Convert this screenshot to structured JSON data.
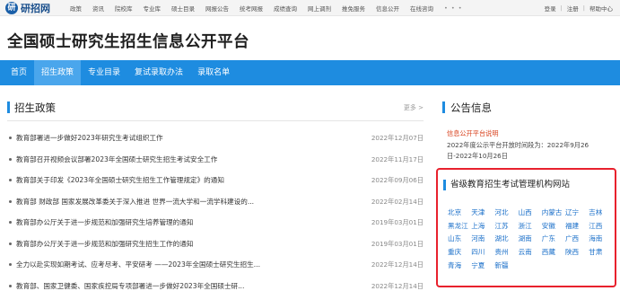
{
  "topbar": {
    "logo_mark": "研",
    "logo_text": "研招网",
    "nav": [
      "政策",
      "资讯",
      "院校库",
      "专业库",
      "硕士目录",
      "网报公告",
      "统考网报",
      "成绩查询",
      "网上调剂",
      "推免服务",
      "信息公开",
      "在线咨询"
    ],
    "more": "• • •",
    "right": {
      "login": "登录",
      "register": "注册",
      "help": "帮助中心"
    }
  },
  "banner": {
    "title": "全国硕士研究生招生信息公开平台"
  },
  "mainnav": [
    "首页",
    "招生政策",
    "专业目录",
    "复试录取办法",
    "录取名单"
  ],
  "policy": {
    "title": "招生政策",
    "more": "更多 >",
    "items": [
      {
        "title": "教育部署进一步做好2023年研究生考试组织工作",
        "date": "2022年12月07日"
      },
      {
        "title": "教育部召开视频会议部署2023年全国硕士研究生招生考试安全工作",
        "date": "2022年11月17日"
      },
      {
        "title": "教育部关于印发《2023年全国硕士研究生招生工作管理规定》的通知",
        "date": "2022年09月06日"
      },
      {
        "title": "教育部 财政部 国家发展改革委关于深入推进 世界一流大学和一流学科建设的...",
        "date": "2022年02月14日"
      },
      {
        "title": "教育部办公厅关于进一步规范和加强研究生培养管理的通知",
        "date": "2019年03月01日"
      },
      {
        "title": "教育部办公厅关于进一步规范和加强研究生招生工作的通知",
        "date": "2019年03月01日"
      },
      {
        "title": "全力以赴实现如期考试、应考尽考、平安研考 ——2023年全国硕士研究生招生...",
        "date": "2022年12月14日"
      },
      {
        "title": "教育部、国家卫健委、国家疾控局专项部署进一步做好2023年全国硕士研...",
        "date": "2022年12月14日"
      }
    ]
  },
  "announce": {
    "title": "公告信息",
    "link": "信息公开平台说明",
    "text": "2022年度公示平台开放时间段为：2022年9月26日-2022年10月26日"
  },
  "provinces": {
    "title": "省级教育招生考试管理机构网站",
    "items": [
      "北京",
      "天津",
      "河北",
      "山西",
      "内蒙古",
      "辽宁",
      "吉林",
      "黑龙江",
      "上海",
      "江苏",
      "浙江",
      "安徽",
      "福建",
      "江西",
      "山东",
      "河南",
      "湖北",
      "湖南",
      "广东",
      "广西",
      "海南",
      "重庆",
      "四川",
      "贵州",
      "云南",
      "西藏",
      "陕西",
      "甘肃",
      "青海",
      "宁夏",
      "新疆"
    ]
  },
  "colors": {
    "nav_blue": "#1e8ce0",
    "highlight_red": "#e8212d",
    "link_blue": "#1a6fc9",
    "notice_red": "#d9431f"
  }
}
